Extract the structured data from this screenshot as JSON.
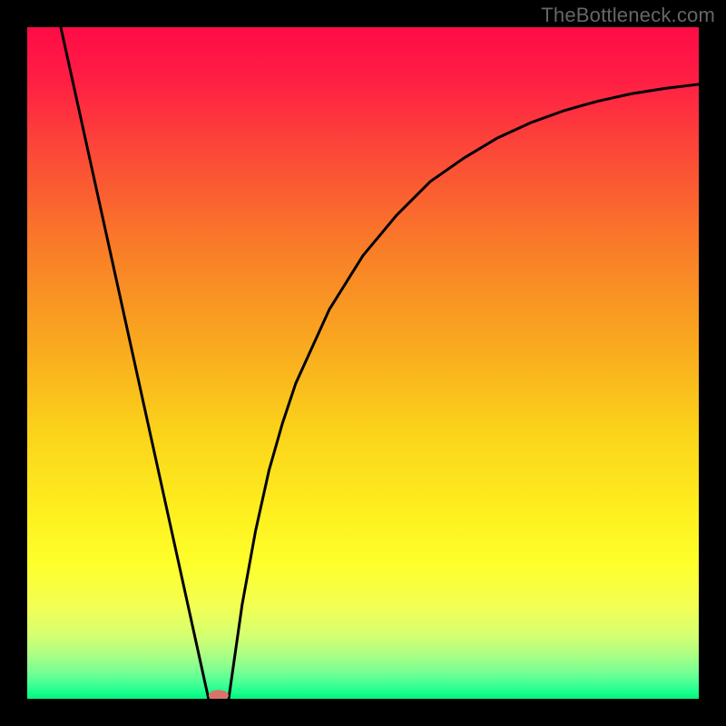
{
  "watermark": "TheBottleneck.com",
  "chart_data": {
    "type": "line",
    "title": "",
    "xlabel": "",
    "ylabel": "",
    "xlim": [
      0,
      100
    ],
    "ylim": [
      0,
      100
    ],
    "grid": false,
    "legend": false,
    "series": [
      {
        "name": "left-slope",
        "x": [
          5,
          27
        ],
        "y": [
          100,
          0
        ]
      },
      {
        "name": "right-curve",
        "x": [
          30,
          32,
          34,
          36,
          38,
          40,
          45,
          50,
          55,
          60,
          65,
          70,
          75,
          80,
          85,
          90,
          95,
          100
        ],
        "y": [
          0,
          14,
          25,
          34,
          41,
          47,
          58,
          66,
          72,
          77,
          80.5,
          83.5,
          85.8,
          87.6,
          89,
          90.1,
          90.9,
          91.5
        ]
      }
    ],
    "marker": {
      "name": "bottleneck-point",
      "x": 28.5,
      "y": 0.5,
      "color": "#d9736a"
    },
    "gradient_stops": [
      {
        "offset": 0.0,
        "color": "#ff0b47"
      },
      {
        "offset": 0.08,
        "color": "#ff1f44"
      },
      {
        "offset": 0.2,
        "color": "#fb4e36"
      },
      {
        "offset": 0.33,
        "color": "#f97d28"
      },
      {
        "offset": 0.47,
        "color": "#f9a81f"
      },
      {
        "offset": 0.6,
        "color": "#fbd21a"
      },
      {
        "offset": 0.73,
        "color": "#fef120"
      },
      {
        "offset": 0.8,
        "color": "#feff2c"
      },
      {
        "offset": 0.86,
        "color": "#f3ff52"
      },
      {
        "offset": 0.905,
        "color": "#d6ff70"
      },
      {
        "offset": 0.935,
        "color": "#aaff84"
      },
      {
        "offset": 0.958,
        "color": "#7bff91"
      },
      {
        "offset": 0.975,
        "color": "#4cff95"
      },
      {
        "offset": 0.99,
        "color": "#1aff8d"
      },
      {
        "offset": 1.0,
        "color": "#02f57c"
      }
    ]
  }
}
